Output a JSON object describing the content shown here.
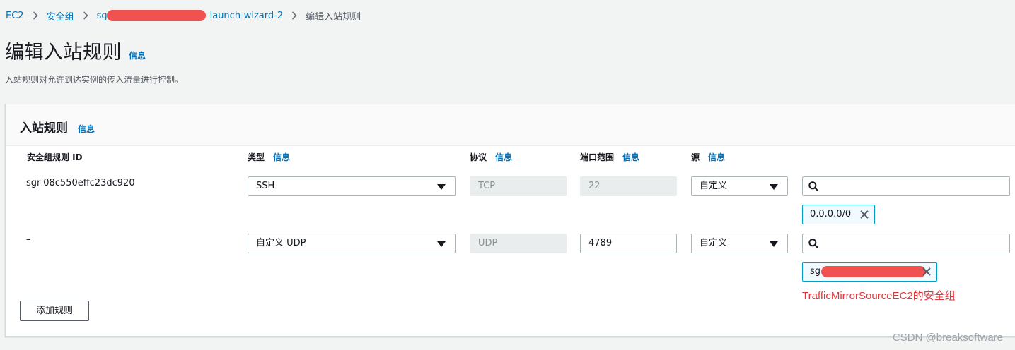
{
  "breadcrumb": {
    "items": [
      "EC2",
      "安全组",
      "sg",
      "launch-wizard-2"
    ],
    "current": "编辑入站规则"
  },
  "page": {
    "title": "编辑入站规则",
    "info": "信息",
    "description": "入站规则对允许到达实例的传入流量进行控制。"
  },
  "panel": {
    "title": "入站规则",
    "info": "信息",
    "columns": {
      "id": "安全组规则 ID",
      "type": "类型",
      "protocol": "协议",
      "port": "端口范围",
      "source": "源",
      "info": "信息"
    },
    "rules": [
      {
        "id": "sgr-08c550effc23dc920",
        "type": "SSH",
        "protocol": "TCP",
        "port": "22",
        "source_type": "自定义",
        "search_value": "",
        "token": "0.0.0.0/0"
      },
      {
        "id": "–",
        "type": "自定义 UDP",
        "protocol": "UDP",
        "port": "4789",
        "source_type": "自定义",
        "search_value": "",
        "token": "sg"
      }
    ],
    "add_button": "添加规则"
  },
  "annotation": "TrafficMirrorSourceEC2的安全组",
  "watermark": "CSDN @breaksoftware",
  "colors": {
    "link": "#0073bb",
    "annotation": "#e1363c",
    "redaction": "#f05252",
    "token_border": "#00a1c9"
  }
}
